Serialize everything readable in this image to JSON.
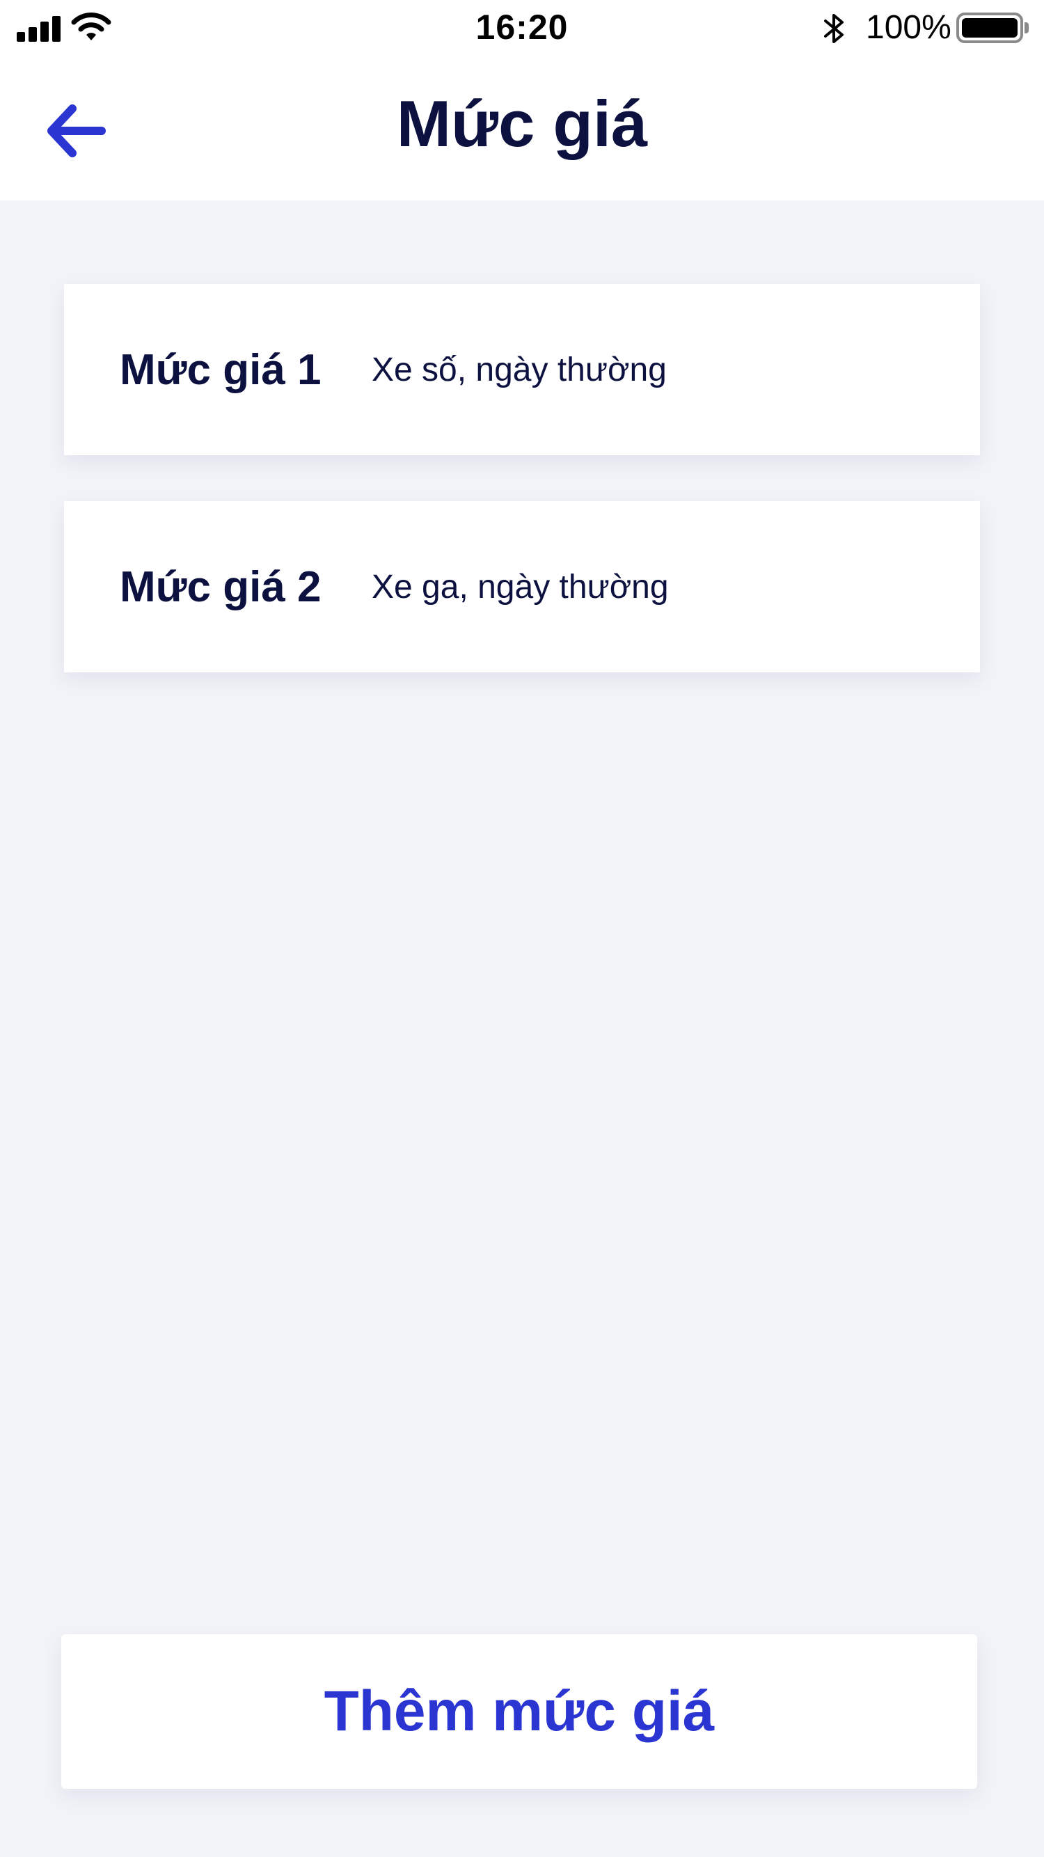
{
  "status_bar": {
    "time": "16:20",
    "battery_percent": "100%",
    "signal_bars": 4,
    "battery_level": 1.0
  },
  "header": {
    "title": "Mức giá",
    "back_icon": "arrow-left-icon"
  },
  "price_levels": [
    {
      "title": "Mức giá 1",
      "description": "Xe số, ngày thường"
    },
    {
      "title": "Mức giá 2",
      "description": "Xe ga, ngày thường"
    }
  ],
  "add_button": {
    "label": "Thêm mức giá"
  },
  "colors": {
    "accent": "#2b35d1",
    "text": "#0d1140",
    "background": "#f2f3f8",
    "card": "#ffffff"
  }
}
